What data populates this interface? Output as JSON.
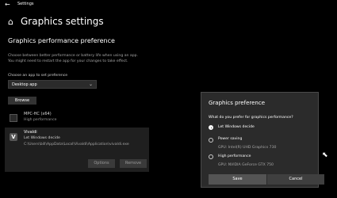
{
  "window": {
    "title": "Settings"
  },
  "page": {
    "title": "Graphics settings",
    "section_title": "Graphics performance preference",
    "description_line1": "Choose between better performance or battery life when using an app.",
    "description_line2": "You might need to restart the app for your changes to take effect.",
    "choose_label": "Choose an app to set preference",
    "dropdown_value": "Desktop app",
    "browse_label": "Browse"
  },
  "apps": [
    {
      "name": "MPC-HC (x64)",
      "preference": "High performance",
      "icon": "mpc-icon"
    },
    {
      "name": "Vivaldi",
      "preference": "Let Windows decide",
      "path": "C:\\Users\\bill\\AppData\\Local\\Vivaldi\\Application\\vivaldi.exe",
      "icon": "vivaldi-icon",
      "options_label": "Options",
      "remove_label": "Remove"
    }
  ],
  "dialog": {
    "title": "Graphics preference",
    "question": "What do you prefer for graphics performance?",
    "options": [
      {
        "label": "Let Windows decide",
        "sub": "",
        "selected": true
      },
      {
        "label": "Power saving",
        "sub": "GPU: Intel(R) UHD Graphics 730",
        "selected": false
      },
      {
        "label": "High performance",
        "sub": "GPU: NVIDIA GeForce GTX 750",
        "selected": false
      }
    ],
    "save_label": "Save",
    "cancel_label": "Cancel"
  },
  "colors": {
    "background": "#000000",
    "dialog_bg": "#2b2b2b",
    "text": "#ffffff",
    "muted": "#a6a6a6"
  }
}
